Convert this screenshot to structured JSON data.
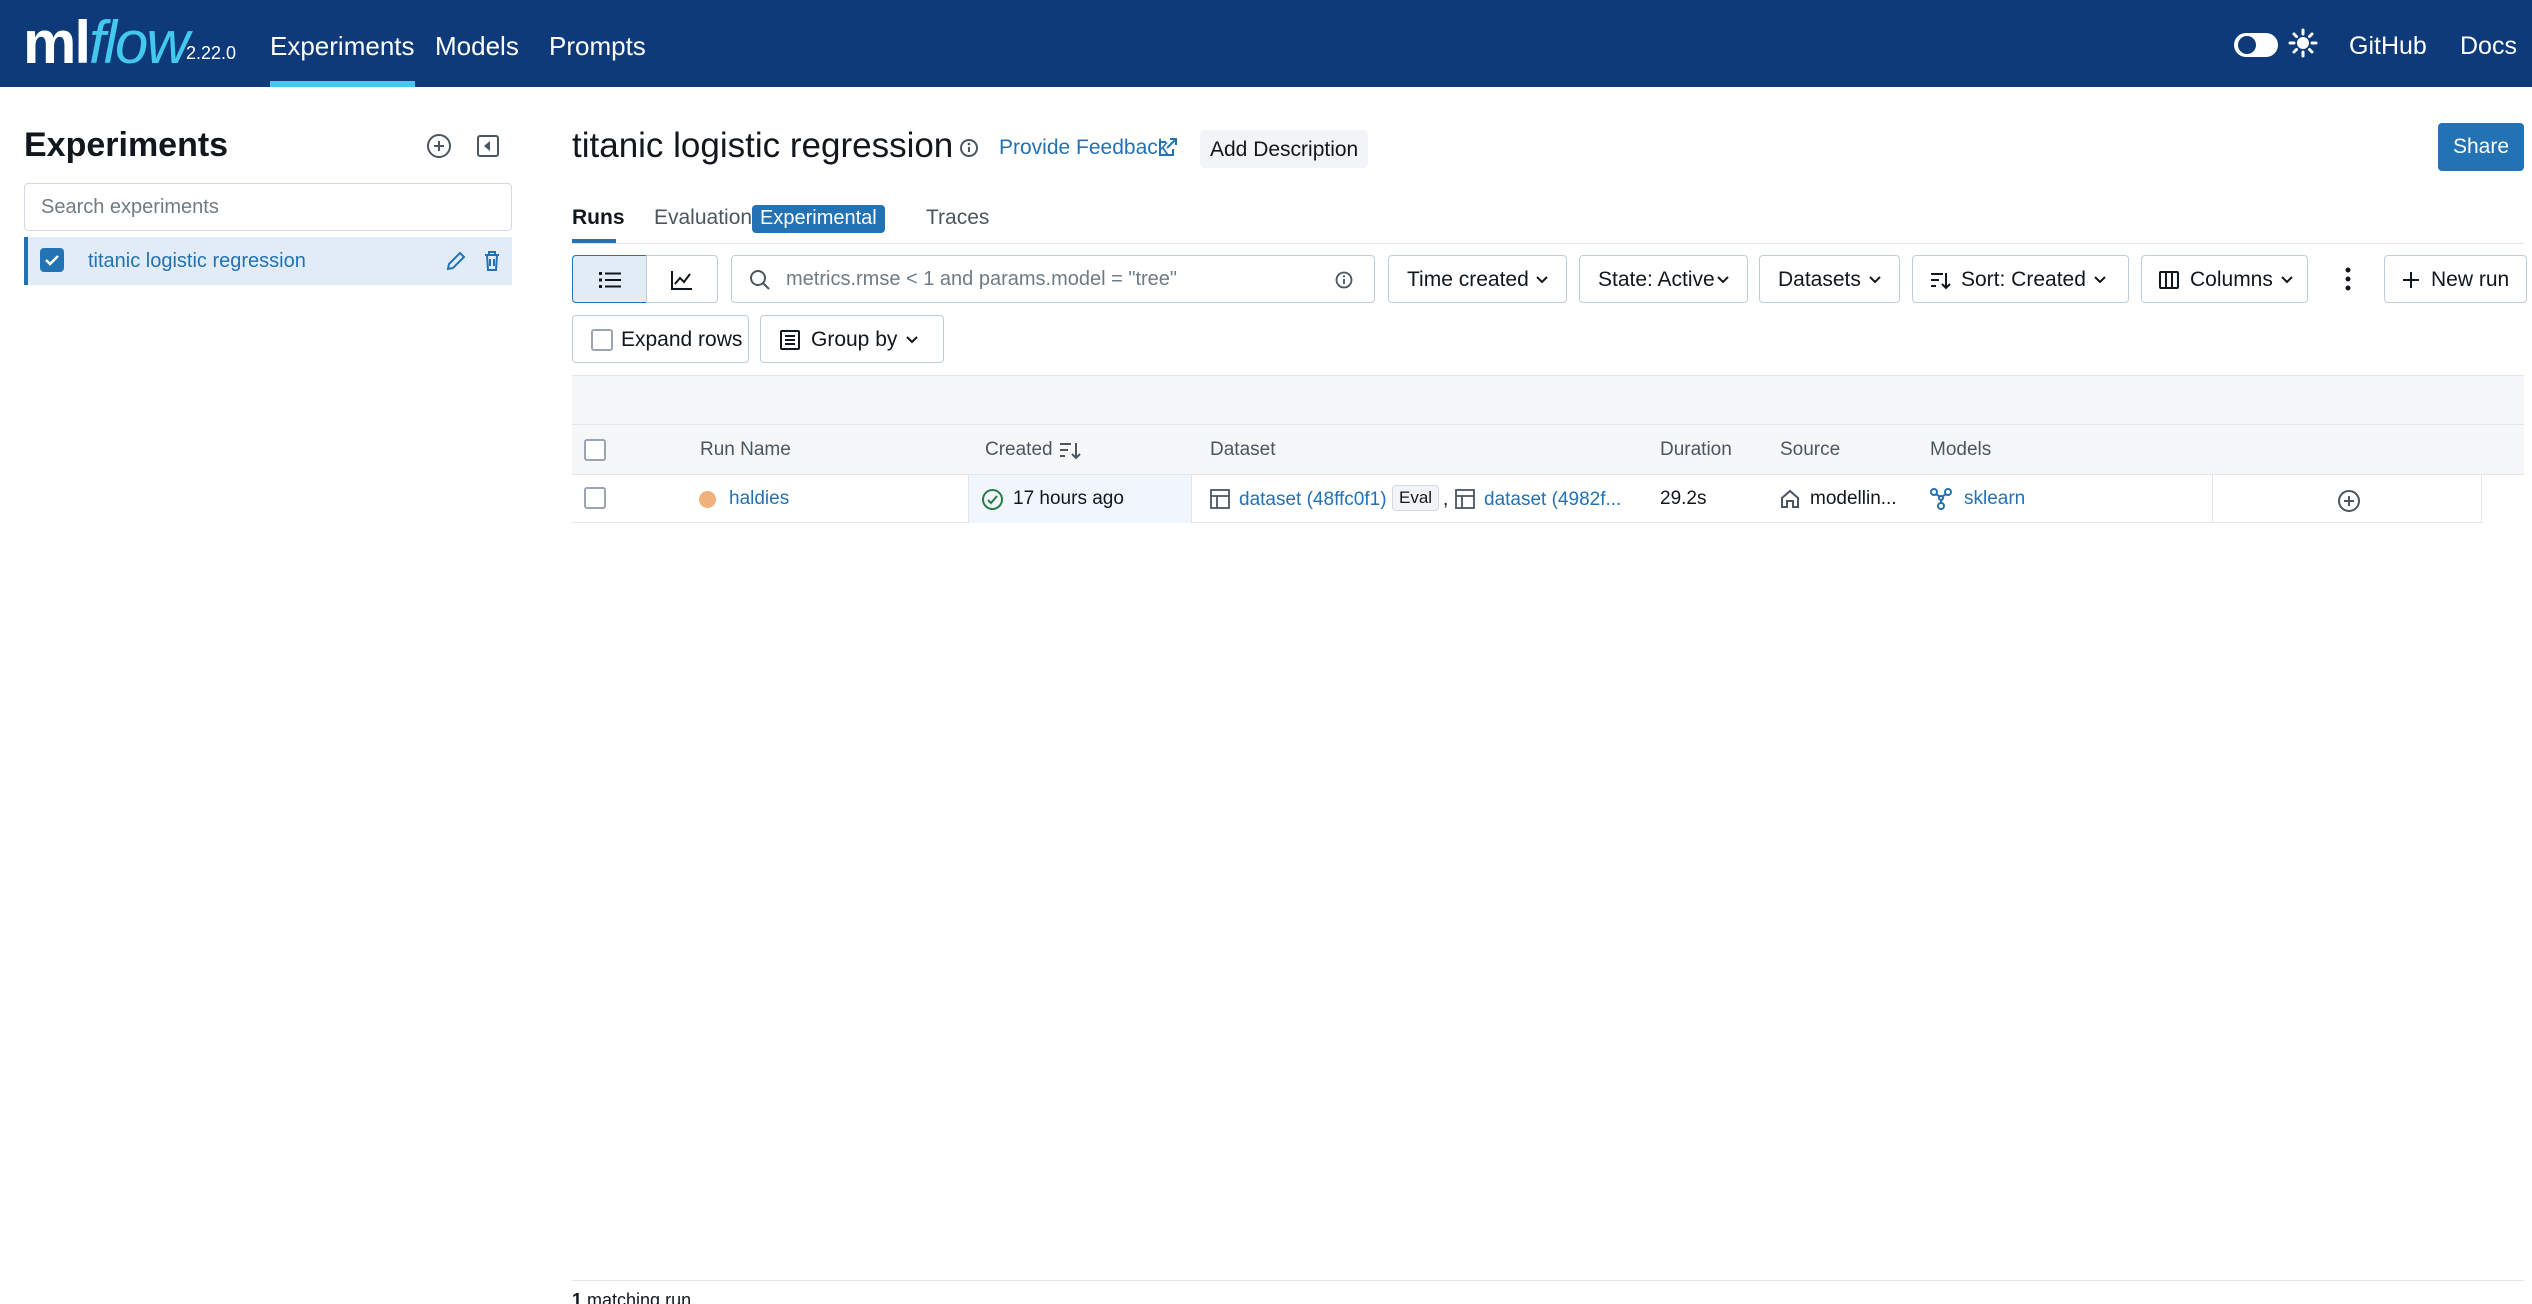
{
  "app": {
    "logo_ml": "ml",
    "logo_flow": "flow",
    "version": "2.22.0",
    "nav": [
      {
        "label": "Experiments",
        "active": true
      },
      {
        "label": "Models",
        "active": false
      },
      {
        "label": "Prompts",
        "active": false
      }
    ],
    "links": {
      "github": "GitHub",
      "docs": "Docs"
    },
    "colors": {
      "topbar": "#0e3a7a",
      "accent": "#43c9ed",
      "primary": "#2272b4"
    }
  },
  "sidebar": {
    "title": "Experiments",
    "search_placeholder": "Search experiments",
    "experiments": [
      {
        "name": "titanic logistic regression",
        "checked": true
      }
    ]
  },
  "header": {
    "title": "titanic logistic regression",
    "feedback": "Provide Feedback",
    "add_description": "Add Description",
    "share": "Share"
  },
  "tabs": {
    "runs": "Runs",
    "evaluation": "Evaluation",
    "experimental_badge": "Experimental",
    "traces": "Traces"
  },
  "toolbar": {
    "search_placeholder": "metrics.rmse < 1 and params.model = \"tree\"",
    "time_created": "Time created",
    "state": "State: Active",
    "datasets": "Datasets",
    "sort": "Sort: Created",
    "columns": "Columns",
    "new_run": "New run",
    "expand_rows": "Expand rows",
    "group_by": "Group by"
  },
  "table": {
    "columns": [
      "Run Name",
      "Created",
      "Dataset",
      "Duration",
      "Source",
      "Models"
    ],
    "rows": [
      {
        "run_name": "haldies",
        "created": "17 hours ago",
        "dataset_1": "dataset (48ffc0f1)",
        "dataset_1_badge": "Eval",
        "separator": ",",
        "dataset_2": "dataset (4982f...",
        "duration": "29.2s",
        "source": "modellin...",
        "model": "sklearn"
      }
    ]
  },
  "footer": {
    "count": "1",
    "text": "matching run"
  }
}
